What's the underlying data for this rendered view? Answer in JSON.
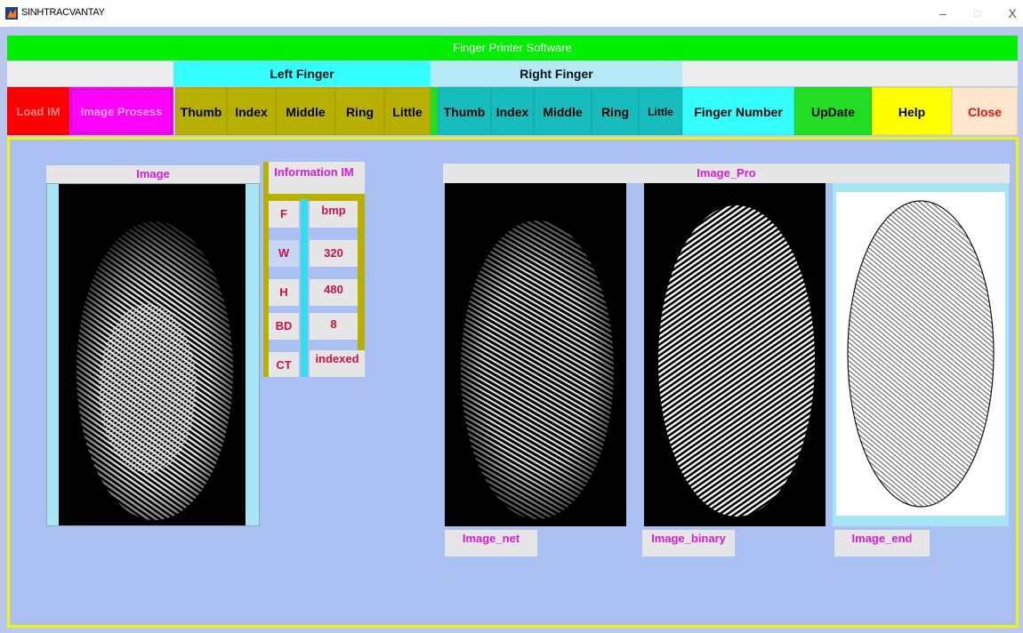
{
  "window": {
    "title": "SINHTRACVANTAY",
    "minimize_glyph": "–",
    "maximize_glyph": "□",
    "close_glyph": "X"
  },
  "header": {
    "title": "Finger Printer Software"
  },
  "groups": {
    "left": "Left Finger",
    "right": "Right Finger"
  },
  "toolbar": {
    "load": "Load IM",
    "process": "Image Prosess",
    "left_thumb": "Thumb",
    "left_index": "Index",
    "left_middle": "Middle",
    "left_ring": "Ring",
    "left_little": "Little",
    "right_thumb": "Thumb",
    "right_index": "Index",
    "right_middle": "Middle",
    "right_ring": "Ring",
    "right_little": "Little",
    "finger_number": "Finger Number",
    "update": "UpDate",
    "help": "Help",
    "close": "Close"
  },
  "image_panel": {
    "title": "Image"
  },
  "info": {
    "title": "Information IM",
    "rows": [
      {
        "key": "F",
        "value": "bmp"
      },
      {
        "key": "W",
        "value": "320"
      },
      {
        "key": "H",
        "value": "480"
      },
      {
        "key": "BD",
        "value": "8"
      },
      {
        "key": "CT",
        "value": "indexed"
      }
    ]
  },
  "pro_panel": {
    "title": "Image_Pro",
    "net_label": "Image_net",
    "binary_label": "Image_binary",
    "end_label": "Image_end"
  },
  "colors": {
    "load": "#ff0000",
    "process": "#ff00ff",
    "left": "#b8b000",
    "right": "#17bcbc",
    "finger_number": "#33ffff",
    "update": "#22dd22",
    "help": "#ffff00",
    "close": "#ffe6cc",
    "header": "#00ee00",
    "canvas": "#aabff2",
    "border": "#f5f500"
  }
}
